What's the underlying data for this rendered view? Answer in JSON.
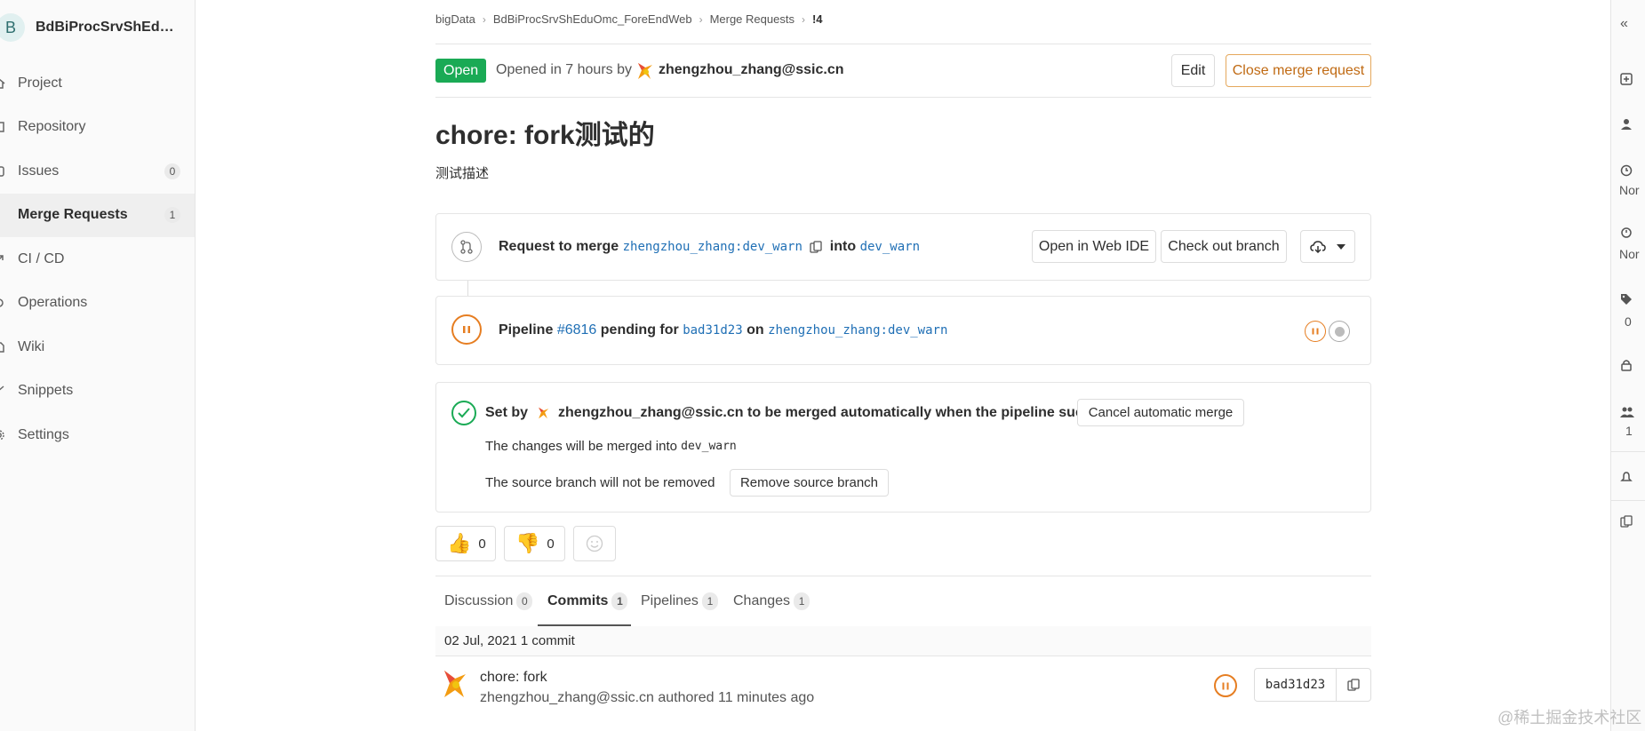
{
  "sidebar": {
    "project_initial": "B",
    "project_name": "BdBiProcSrvShEduO...",
    "items": [
      {
        "label": "Project"
      },
      {
        "label": "Repository"
      },
      {
        "label": "Issues",
        "count": "0"
      },
      {
        "label": "Merge Requests",
        "count": "1"
      },
      {
        "label": "CI / CD"
      },
      {
        "label": "Operations"
      },
      {
        "label": "Wiki"
      },
      {
        "label": "Snippets"
      },
      {
        "label": "Settings"
      }
    ]
  },
  "breadcrumb": {
    "items": [
      "bigData",
      "BdBiProcSrvShEduOmc_ForeEndWeb",
      "Merge Requests",
      "!4"
    ]
  },
  "header": {
    "status": "Open",
    "opened_text": "Opened in 7 hours by",
    "author": "zhengzhou_zhang@ssic.cn",
    "edit_label": "Edit",
    "close_label": "Close merge request"
  },
  "mr": {
    "title": "chore: fork测试的",
    "description": "测试描述"
  },
  "merge_widget": {
    "prefix": "Request to merge",
    "source_ns": "zhengzhou_zhang",
    "source_branch": "dev_warn",
    "into": "into",
    "target_branch": "dev_warn",
    "web_ide_label": "Open in Web IDE",
    "checkout_label": "Check out branch"
  },
  "pipeline": {
    "label": "Pipeline",
    "id": "#6816",
    "status_text": "pending for",
    "sha": "bad31d23",
    "on": "on",
    "ns": "zhengzhou_zhang",
    "branch": "dev_warn"
  },
  "auto_merge": {
    "set_by": "Set by",
    "user": "zhengzhou_zhang@ssic.cn",
    "suffix": "to be merged automatically when the pipeline succeeds",
    "cancel_label": "Cancel automatic merge",
    "changes_text": "The changes will be merged into",
    "changes_branch": "dev_warn",
    "source_text": "The source branch will not be removed",
    "remove_label": "Remove source branch"
  },
  "awards": {
    "thumbsup": "0",
    "thumbsdown": "0"
  },
  "tabs": [
    {
      "label": "Discussion",
      "count": "0"
    },
    {
      "label": "Commits",
      "count": "1"
    },
    {
      "label": "Pipelines",
      "count": "1"
    },
    {
      "label": "Changes",
      "count": "1"
    }
  ],
  "commits": {
    "day": "02 Jul, 2021 1 commit",
    "title": "chore: fork",
    "meta": "zhengzhou_zhang@ssic.cn authored 11 minutes ago",
    "sha": "bad31d23"
  },
  "right_sidebar": {
    "time_est": "Nor",
    "time_spent": "Nor",
    "labels_count": "0",
    "participants_count": "1"
  },
  "watermark": "@稀土掘金技术社区",
  "colors": {
    "open_badge": "#1aaa55",
    "link": "#1f6fb5",
    "pending": "#e67e22",
    "success": "#1aaa55",
    "close_border": "#e5a85c"
  }
}
